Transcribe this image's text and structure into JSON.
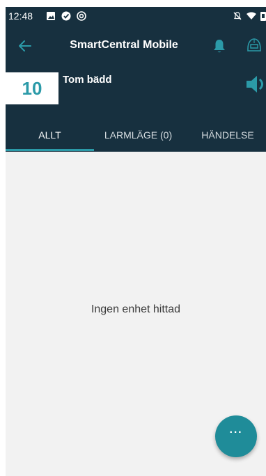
{
  "status_bar": {
    "time": "12:48",
    "icons": [
      "image-icon",
      "check-circle-icon",
      "at-sign-icon",
      "notifications-off-icon",
      "wifi-icon",
      "battery-icon"
    ]
  },
  "appbar": {
    "title": "SmartCentral Mobile",
    "back_icon": "arrow-left-icon",
    "alert_icon": "bell-icon",
    "profile_icon": "helmet-icon"
  },
  "bed": {
    "number": "10",
    "name": "Tom bädd",
    "sound_icon": "speaker-icon"
  },
  "tabs": [
    {
      "label": "ALLT",
      "active": true
    },
    {
      "label": "LARMLÄGE (0)",
      "active": false
    },
    {
      "label": "HÄNDELSE",
      "active": false
    }
  ],
  "main": {
    "empty_message": "Ingen enhet hittad"
  },
  "fab": {
    "label": "···",
    "icon": "more-horizontal-icon"
  },
  "colors": {
    "header_bg": "#17303f",
    "accent": "#2b9aa8",
    "background": "#f2f2f2"
  }
}
